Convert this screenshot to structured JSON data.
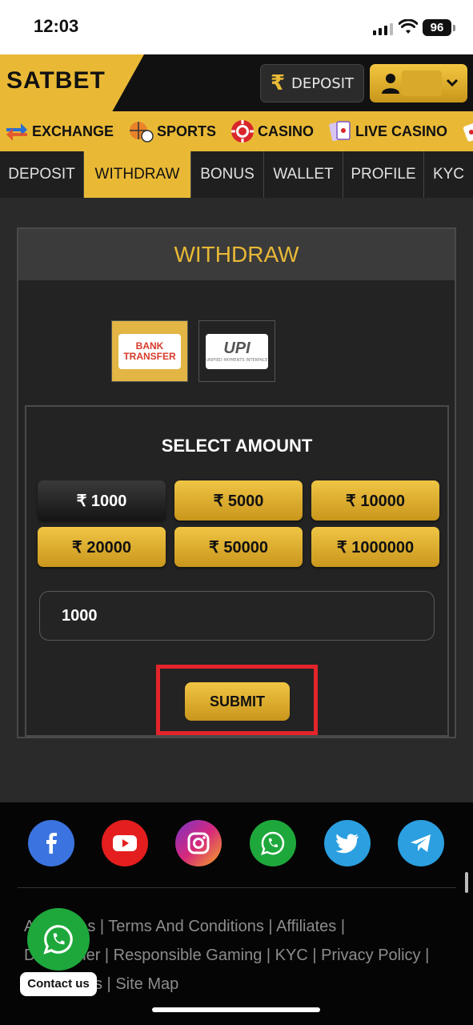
{
  "status_bar": {
    "time": "12:03",
    "battery": "96"
  },
  "header": {
    "logo": "SATBET",
    "deposit_label": "DEPOSIT"
  },
  "nav": {
    "items": [
      "EXCHANGE",
      "SPORTS",
      "CASINO",
      "LIVE CASINO"
    ]
  },
  "tabs": [
    {
      "label": "DEPOSIT"
    },
    {
      "label": "WITHDRAW",
      "active": true
    },
    {
      "label": "BONUS"
    },
    {
      "label": "WALLET"
    },
    {
      "label": "PROFILE"
    },
    {
      "label": "KYC"
    }
  ],
  "withdraw": {
    "title": "WITHDRAW",
    "methods": [
      {
        "name": "bank-transfer",
        "line1": "BANK",
        "line2": "TRANSFER",
        "selected": true
      },
      {
        "name": "upi",
        "line1": "UPI",
        "line2": "UNIFIED PAYMENTS INTERFACE",
        "selected": false
      }
    ],
    "select_amount_label": "SELECT AMOUNT",
    "amounts": [
      "₹ 1000",
      "₹ 5000",
      "₹ 10000",
      "₹ 20000",
      "₹ 50000",
      "₹ 1000000"
    ],
    "selected_amount": "₹ 1000",
    "amount_value": "1000",
    "submit_label": "SUBMIT"
  },
  "footer": {
    "social": [
      "facebook",
      "youtube",
      "instagram",
      "whatsapp",
      "twitter",
      "telegram"
    ],
    "links_row1": [
      "A",
      "s",
      "Terms And Conditions",
      "Affiliates"
    ],
    "links_row2": [
      "D",
      "ner",
      "Responsible Gaming",
      "KYC",
      "Privacy Policy"
    ],
    "links_row3": [
      "s",
      "Site Map"
    ],
    "contact_label": "Contact us"
  },
  "colors": {
    "accent": "#e9b936",
    "highlight": "#e3242b",
    "whatsapp": "#1ea83b"
  }
}
